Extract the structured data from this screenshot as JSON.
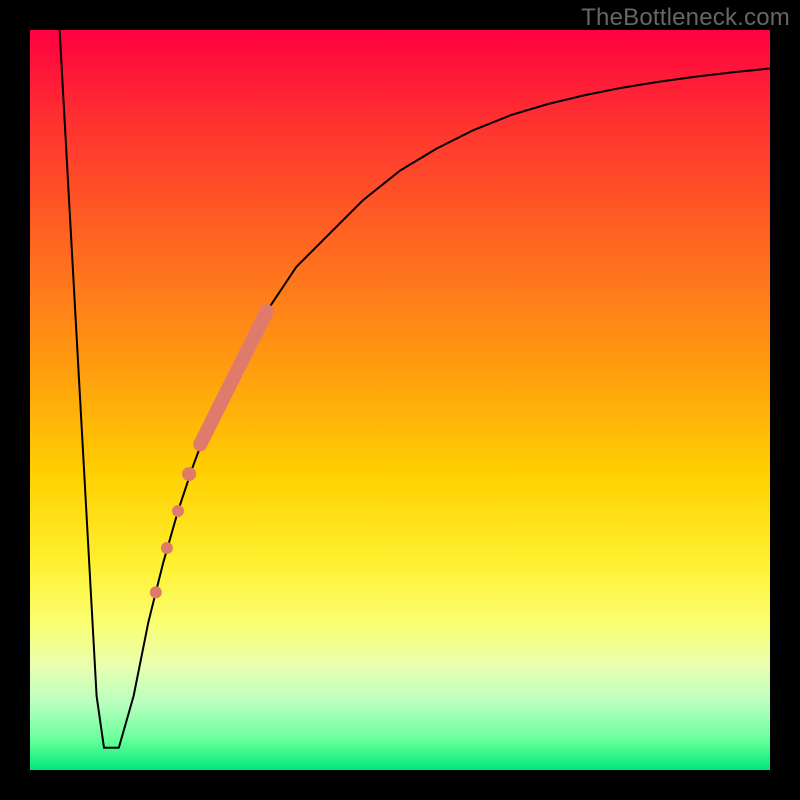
{
  "watermark": "TheBottleneck.com",
  "chart_data": {
    "type": "line",
    "title": "",
    "xlabel": "",
    "ylabel": "",
    "xlim": [
      0,
      100
    ],
    "ylim": [
      0,
      100
    ],
    "grid": false,
    "background_gradient": {
      "direction": "vertical",
      "stops": [
        {
          "pos": 0.0,
          "color": "#ff0040"
        },
        {
          "pos": 0.12,
          "color": "#ff3030"
        },
        {
          "pos": 0.3,
          "color": "#ff6a20"
        },
        {
          "pos": 0.45,
          "color": "#ff9a10"
        },
        {
          "pos": 0.6,
          "color": "#ffd000"
        },
        {
          "pos": 0.72,
          "color": "#fff030"
        },
        {
          "pos": 0.8,
          "color": "#faff70"
        },
        {
          "pos": 0.86,
          "color": "#e8ffb0"
        },
        {
          "pos": 0.91,
          "color": "#b8ffc0"
        },
        {
          "pos": 0.96,
          "color": "#66ff9a"
        },
        {
          "pos": 1.0,
          "color": "#00e879"
        }
      ]
    },
    "series": [
      {
        "name": "curve",
        "stroke": "#000000",
        "stroke_width": 2,
        "x": [
          4,
          6,
          8,
          9,
          10,
          11,
          12,
          14,
          16,
          18,
          20,
          22,
          25,
          28,
          32,
          36,
          40,
          45,
          50,
          55,
          60,
          65,
          70,
          75,
          80,
          85,
          90,
          95,
          100
        ],
        "y": [
          100,
          64,
          28,
          10,
          3,
          3,
          3,
          10,
          20,
          28,
          35,
          41,
          49,
          55,
          62,
          68,
          72,
          77,
          81,
          84,
          86.5,
          88.5,
          90,
          91.2,
          92.2,
          93,
          93.7,
          94.3,
          94.8
        ]
      }
    ],
    "markers": [
      {
        "name": "thick-segment",
        "type": "segment",
        "stroke": "#e07a6a",
        "stroke_width": 14,
        "x": [
          23,
          32
        ],
        "y": [
          44,
          62
        ]
      },
      {
        "name": "dot-1",
        "type": "dot",
        "fill": "#e07a6a",
        "r": 7,
        "x": 21.5,
        "y": 40
      },
      {
        "name": "dot-2",
        "type": "dot",
        "fill": "#e07a6a",
        "r": 6,
        "x": 20.0,
        "y": 35
      },
      {
        "name": "dot-3",
        "type": "dot",
        "fill": "#e07a6a",
        "r": 6,
        "x": 18.5,
        "y": 30
      },
      {
        "name": "dot-4",
        "type": "dot",
        "fill": "#e07a6a",
        "r": 6,
        "x": 17.0,
        "y": 24
      }
    ]
  }
}
